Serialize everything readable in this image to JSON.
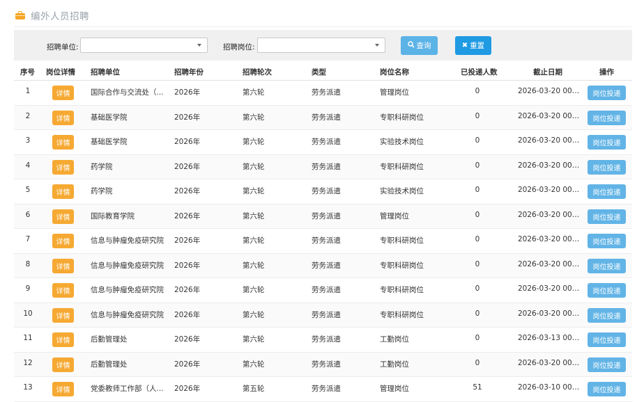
{
  "page": {
    "title": "编外人员招聘",
    "icon": "briefcase-icon"
  },
  "filters": {
    "unit_label": "招聘单位:",
    "unit_value": "",
    "position_label": "招聘岗位:",
    "position_value": "",
    "search_label": "查询",
    "reset_label": "重置"
  },
  "columns": [
    "序号",
    "岗位详情",
    "招聘单位",
    "招聘年份",
    "招聘轮次",
    "类型",
    "岗位名称",
    "已投递人数",
    "截止日期",
    "操作"
  ],
  "detail_label": "详情",
  "apply_label": "岗位投递",
  "rows": [
    {
      "no": "1",
      "unit": "国际合作与交流处（...",
      "year": "2026年",
      "round": "第六轮",
      "type": "劳务派遣",
      "position": "管理岗位",
      "count": "0",
      "deadline": "2026-03-20 00:0..."
    },
    {
      "no": "2",
      "unit": "基础医学院",
      "year": "2026年",
      "round": "第六轮",
      "type": "劳务派遣",
      "position": "专职科研岗位",
      "count": "0",
      "deadline": "2026-03-20 00:0..."
    },
    {
      "no": "3",
      "unit": "基础医学院",
      "year": "2026年",
      "round": "第六轮",
      "type": "劳务派遣",
      "position": "实验技术岗位",
      "count": "0",
      "deadline": "2026-03-20 00:0..."
    },
    {
      "no": "4",
      "unit": "药学院",
      "year": "2026年",
      "round": "第六轮",
      "type": "劳务派遣",
      "position": "专职科研岗位",
      "count": "0",
      "deadline": "2026-03-20 00:0..."
    },
    {
      "no": "5",
      "unit": "药学院",
      "year": "2026年",
      "round": "第六轮",
      "type": "劳务派遣",
      "position": "实验技术岗位",
      "count": "0",
      "deadline": "2026-03-20 00:0..."
    },
    {
      "no": "6",
      "unit": "国际教育学院",
      "year": "2026年",
      "round": "第六轮",
      "type": "劳务派遣",
      "position": "管理岗位",
      "count": "0",
      "deadline": "2026-03-20 00:0..."
    },
    {
      "no": "7",
      "unit": "信息与肿瘤免疫研究院",
      "year": "2026年",
      "round": "第六轮",
      "type": "劳务派遣",
      "position": "专职科研岗位",
      "count": "0",
      "deadline": "2026-03-20 00:0..."
    },
    {
      "no": "8",
      "unit": "信息与肿瘤免疫研究院",
      "year": "2026年",
      "round": "第六轮",
      "type": "劳务派遣",
      "position": "专职科研岗位",
      "count": "0",
      "deadline": "2026-03-20 00:0..."
    },
    {
      "no": "9",
      "unit": "信息与肿瘤免疫研究院",
      "year": "2026年",
      "round": "第六轮",
      "type": "劳务派遣",
      "position": "专职科研岗位",
      "count": "0",
      "deadline": "2026-03-20 00:0..."
    },
    {
      "no": "10",
      "unit": "信息与肿瘤免疫研究院",
      "year": "2026年",
      "round": "第六轮",
      "type": "劳务派遣",
      "position": "专职科研岗位",
      "count": "0",
      "deadline": "2026-03-20 00:0..."
    },
    {
      "no": "11",
      "unit": "后勤管理处",
      "year": "2026年",
      "round": "第六轮",
      "type": "劳务派遣",
      "position": "工勤岗位",
      "count": "0",
      "deadline": "2026-03-13 00:0..."
    },
    {
      "no": "12",
      "unit": "后勤管理处",
      "year": "2026年",
      "round": "第六轮",
      "type": "劳务派遣",
      "position": "工勤岗位",
      "count": "0",
      "deadline": "2026-03-20 00:0..."
    },
    {
      "no": "13",
      "unit": "党委教师工作部（人...",
      "year": "2026年",
      "round": "第五轮",
      "type": "劳务派遣",
      "position": "管理岗位",
      "count": "51",
      "deadline": "2026-03-10 00:0..."
    }
  ]
}
